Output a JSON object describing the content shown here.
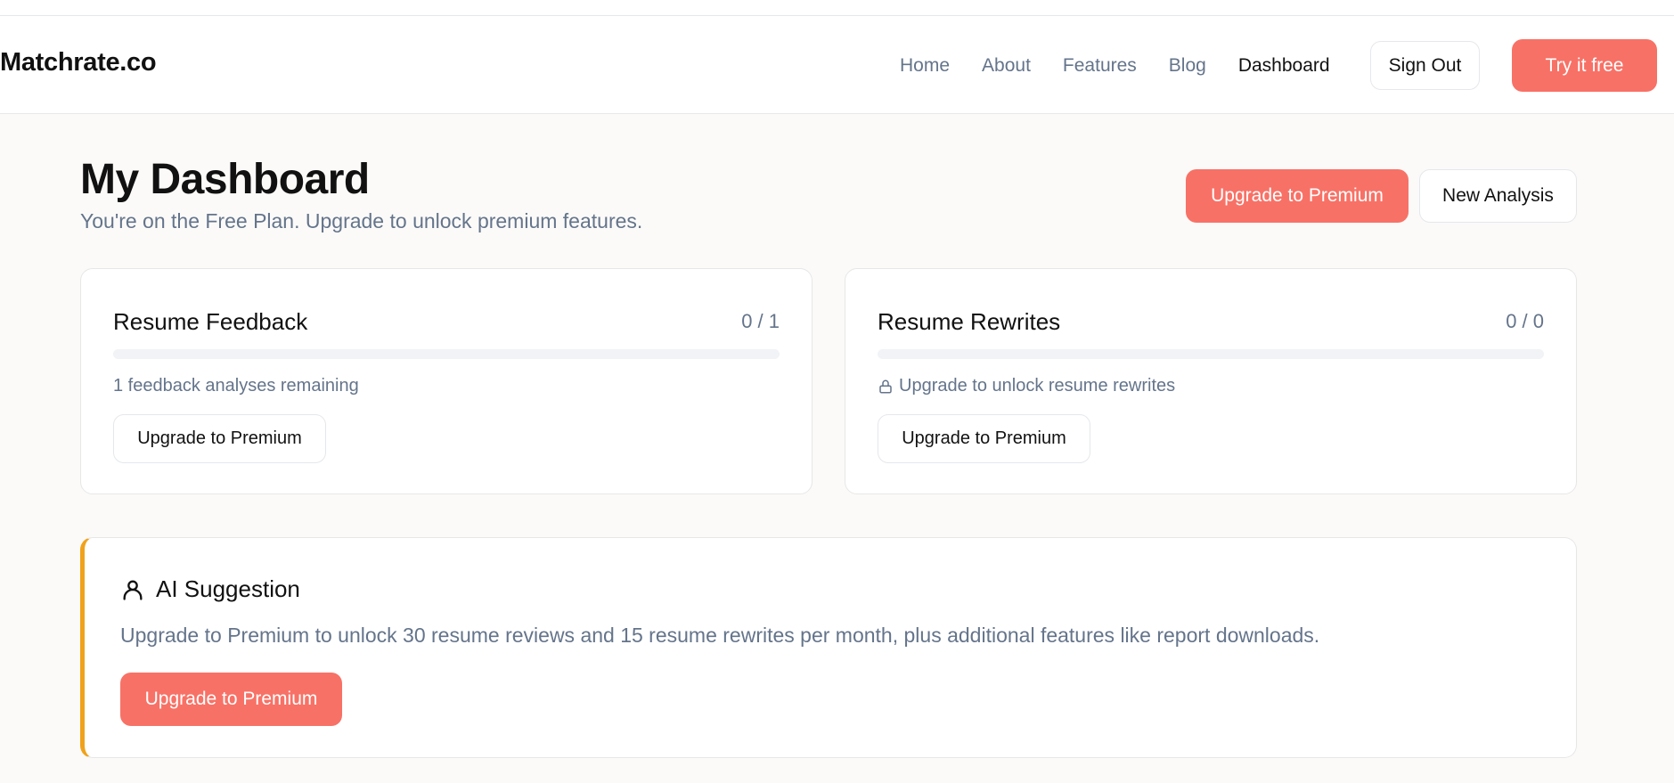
{
  "nav": {
    "brand": "Matchrate.co",
    "links": [
      {
        "label": "Home",
        "active": false
      },
      {
        "label": "About",
        "active": false
      },
      {
        "label": "Features",
        "active": false
      },
      {
        "label": "Blog",
        "active": false
      },
      {
        "label": "Dashboard",
        "active": true
      }
    ],
    "sign_out_label": "Sign Out",
    "try_free_label": "Try it free"
  },
  "header": {
    "title": "My Dashboard",
    "subtitle": "You're on the Free Plan. Upgrade to unlock premium features.",
    "upgrade_label": "Upgrade to Premium",
    "new_analysis_label": "New Analysis"
  },
  "cards": [
    {
      "title": "Resume Feedback",
      "count": "0 / 1",
      "progress": 0,
      "note": "1 feedback analyses remaining",
      "note_icon": "",
      "button_label": "Upgrade to Premium"
    },
    {
      "title": "Resume Rewrites",
      "count": "0 / 0",
      "progress": 0,
      "note": "Upgrade to unlock resume rewrites",
      "note_icon": "lock-icon",
      "button_label": "Upgrade to Premium"
    }
  ],
  "ai_suggestion": {
    "icon": "user-icon",
    "title": "AI Suggestion",
    "text": "Upgrade to Premium to unlock 30 resume reviews and 15 resume rewrites per month, plus additional features like report downloads.",
    "button_label": "Upgrade to Premium"
  },
  "colors": {
    "accent": "#f87166",
    "highlight_border": "#f0a21b",
    "muted_text": "#64748b"
  }
}
